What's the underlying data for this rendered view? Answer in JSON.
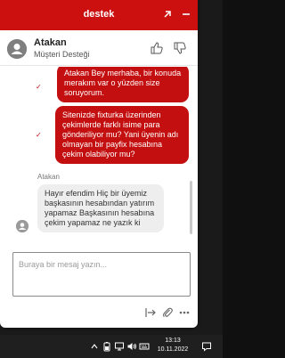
{
  "widget": {
    "title": "destek",
    "colors": {
      "accent": "#cc0f0f",
      "bubble_out": "#c30f0f",
      "bubble_in": "#eeeeee"
    },
    "icons": [
      "external-link-icon",
      "minimize-icon"
    ]
  },
  "agent": {
    "name": "Atakan",
    "department": "Müşteri Desteği",
    "rating_icons": [
      "thumbs-up-icon",
      "thumbs-down-icon"
    ]
  },
  "messages": [
    {
      "direction": "out",
      "text": "Atakan Bey merhaba, bir konuda merakım var o yüzden size soruyorum."
    },
    {
      "direction": "out",
      "text": "Sitenizde fixturka üzerinden çekimlerde farklı isime para gönderiliyor mu? Yani üyenin adı olmayan bir payfix hesabına çekim olabiliyor mu?"
    },
    {
      "direction": "sender",
      "text": "Atakan"
    },
    {
      "direction": "in",
      "text": "Hayır efendim Hiç bir üyemiz başkasının hesabından yatırım yapamaz Başkasının hesabına çekim yapamaz ne yazık ki"
    }
  ],
  "composer": {
    "placeholder": "Buraya bir mesaj yazın..."
  },
  "tools": [
    "transfer-icon",
    "attachment-icon",
    "more-icon"
  ],
  "taskbar": {
    "time": "13:13",
    "date": "10.11.2022",
    "icons": [
      "chevron-up-icon",
      "battery-icon",
      "network-icon",
      "volume-icon",
      "language-icon",
      "notification-icon"
    ]
  }
}
